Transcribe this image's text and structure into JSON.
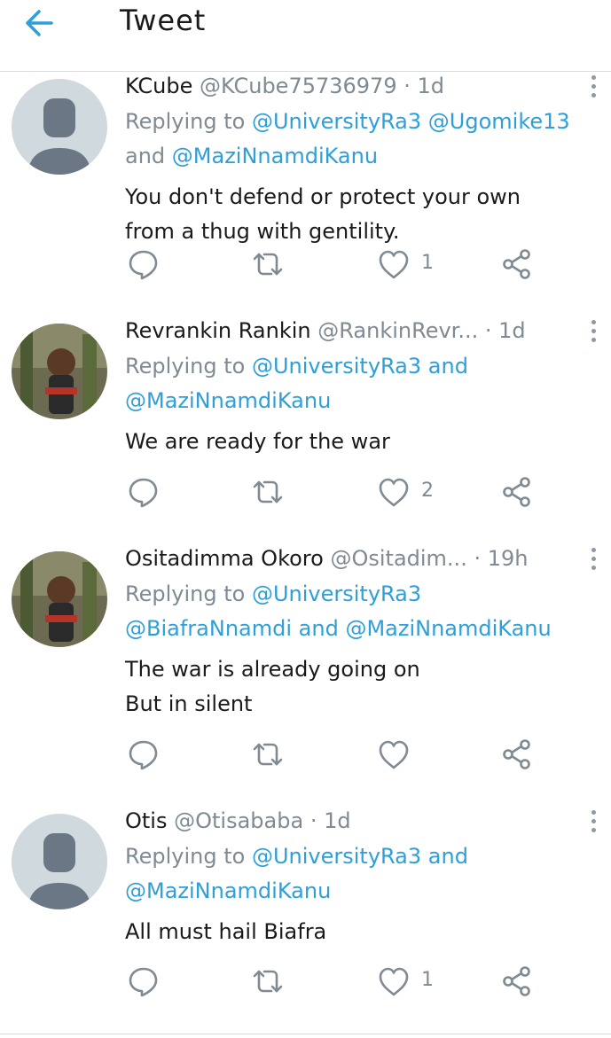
{
  "header": {
    "title": "Tweet",
    "accent": "#2e9fd8"
  },
  "tweets": [
    {
      "name": "KCube",
      "handle": "@KCube75736979",
      "time": "· 1d",
      "reply_prefix": "Replying to",
      "reply_lines": [
        [
          {
            "t": "@UniversityRa3",
            "m": true
          },
          {
            "t": " "
          },
          {
            "t": "@Ugomike13",
            "m": true
          }
        ],
        [
          {
            "t": "and "
          },
          {
            "t": "@MaziNnamdiKanu",
            "m": true
          }
        ]
      ],
      "text_lines": [
        "You don't defend or protect  your own",
        "from a thug with gentility."
      ],
      "likes": "1",
      "avatar": "default-avatar"
    },
    {
      "name": "Revrankin Rankin",
      "handle": "@RankinRevr...",
      "time": "· 1d",
      "reply_prefix": "Replying to",
      "reply_lines": [
        [
          {
            "t": "@UniversityRa3",
            "m": true
          },
          {
            "t": " and",
            "m": true
          }
        ],
        [
          {
            "t": "@MaziNnamdiKanu",
            "m": true
          }
        ]
      ],
      "text_lines": [
        "We are ready for the war"
      ],
      "likes": "2",
      "avatar": "photo-avatar"
    },
    {
      "name": "Ositadimma Okoro",
      "handle": "@Ositadim...",
      "time": "· 19h",
      "reply_prefix": "Replying to",
      "reply_lines": [
        [
          {
            "t": "@UniversityRa3",
            "m": true
          }
        ],
        [
          {
            "t": "@BiafraNnamdi",
            "m": true
          },
          {
            "t": " and ",
            "m": true
          },
          {
            "t": "@MaziNnamdiKanu",
            "m": true
          }
        ]
      ],
      "text_lines": [
        "The war is already going on",
        "But in silent"
      ],
      "likes": "",
      "avatar": "photo-avatar"
    },
    {
      "name": "Otis",
      "handle": "@Otisababa",
      "time": "· 1d",
      "reply_prefix": "Replying to",
      "reply_lines": [
        [
          {
            "t": "@UniversityRa3",
            "m": true
          },
          {
            "t": " and",
            "m": true
          }
        ],
        [
          {
            "t": "@MaziNnamdiKanu",
            "m": true
          }
        ]
      ],
      "text_lines": [
        "All must hail Biafra"
      ],
      "likes": "1",
      "avatar": "default-avatar"
    }
  ]
}
